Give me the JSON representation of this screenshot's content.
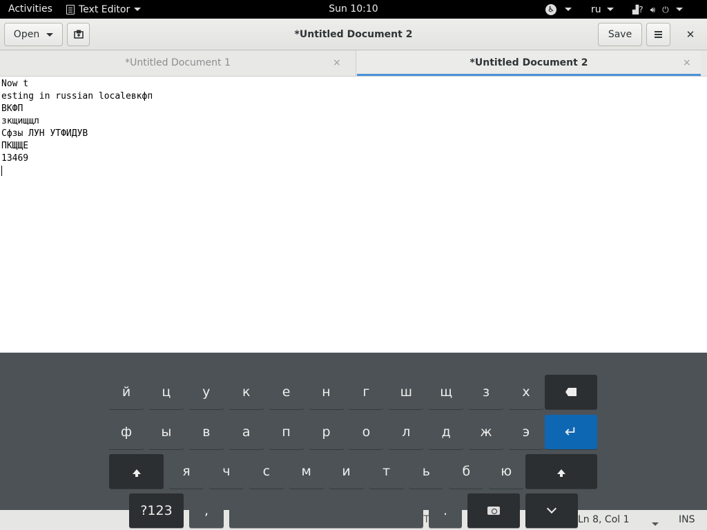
{
  "topbar": {
    "activities": "Activities",
    "app_name": "Text Editor",
    "clock": "Sun 10:10",
    "lang": "ru"
  },
  "header": {
    "open_label": "Open",
    "title": "*Untitled Document 2",
    "save_label": "Save",
    "close_glyph": "✕"
  },
  "tabs": [
    {
      "label": "*Untitled Document 1",
      "active": false,
      "close": "×"
    },
    {
      "label": "*Untitled Document 2",
      "active": true,
      "close": "×"
    }
  ],
  "editor": {
    "lines": [
      "Now t",
      "esting in russian localeвкфп",
      "ВКФП",
      "зкщищщл",
      "Сфзы ЛУН УТФИДУВ",
      "ПКЩЩЕ",
      "13469",
      ""
    ]
  },
  "statusbar": {
    "position": "Ln 8, Col 1",
    "mode": "INS",
    "partial_text": "n T      8"
  },
  "osk": {
    "row1": [
      "й",
      "ц",
      "у",
      "к",
      "е",
      "н",
      "г",
      "ш",
      "щ",
      "з",
      "х"
    ],
    "row2": [
      "ф",
      "ы",
      "в",
      "а",
      "п",
      "р",
      "о",
      "л",
      "д",
      "ж",
      "э"
    ],
    "row3": [
      "я",
      "ч",
      "с",
      "м",
      "и",
      "т",
      "ь",
      "б",
      "ю"
    ],
    "numbers_label": "?123",
    "comma": ",",
    "period": ".",
    "enter_glyph": "↵",
    "accent_color": "#0e67b3"
  }
}
